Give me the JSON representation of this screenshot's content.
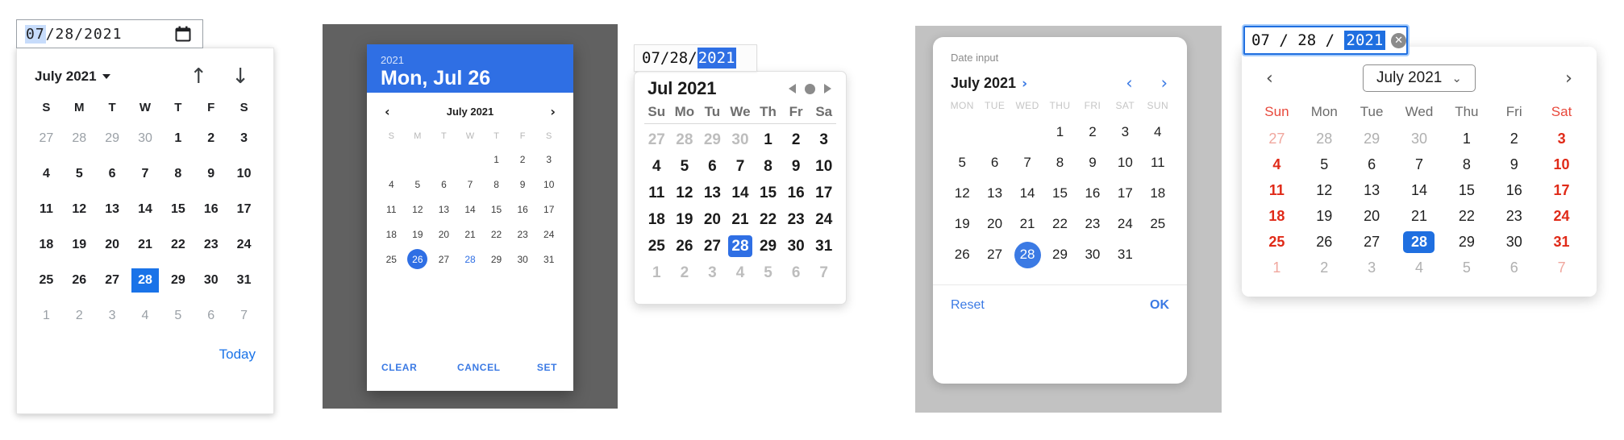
{
  "panels": {
    "chrome": {
      "name": "chrome-date-picker",
      "input": {
        "month": "07",
        "sep1": "/",
        "day": "28",
        "sep2": "/",
        "year": "2021",
        "icon": "calendar-icon",
        "selected_segment": "month"
      },
      "header": {
        "title": "July 2021",
        "dropdown_icon": "caret-down-icon",
        "prev_icon": "arrow-up-icon",
        "prev_glyph": "↑",
        "next_icon": "arrow-down-icon",
        "next_glyph": "↓"
      },
      "dow": [
        "S",
        "M",
        "T",
        "W",
        "T",
        "F",
        "S"
      ],
      "weeks": [
        [
          {
            "d": "27",
            "m": 1
          },
          {
            "d": "28",
            "m": 1
          },
          {
            "d": "29",
            "m": 1
          },
          {
            "d": "30",
            "m": 1
          },
          {
            "d": "1"
          },
          {
            "d": "2"
          },
          {
            "d": "3"
          }
        ],
        [
          {
            "d": "4"
          },
          {
            "d": "5"
          },
          {
            "d": "6"
          },
          {
            "d": "7"
          },
          {
            "d": "8"
          },
          {
            "d": "9"
          },
          {
            "d": "10"
          }
        ],
        [
          {
            "d": "11"
          },
          {
            "d": "12"
          },
          {
            "d": "13"
          },
          {
            "d": "14"
          },
          {
            "d": "15"
          },
          {
            "d": "16"
          },
          {
            "d": "17"
          }
        ],
        [
          {
            "d": "18"
          },
          {
            "d": "19"
          },
          {
            "d": "20"
          },
          {
            "d": "21"
          },
          {
            "d": "22"
          },
          {
            "d": "23"
          },
          {
            "d": "24"
          }
        ],
        [
          {
            "d": "25"
          },
          {
            "d": "26"
          },
          {
            "d": "27"
          },
          {
            "d": "28",
            "s": 1
          },
          {
            "d": "29"
          },
          {
            "d": "30"
          },
          {
            "d": "31"
          }
        ],
        [
          {
            "d": "1",
            "m": 1
          },
          {
            "d": "2",
            "m": 1
          },
          {
            "d": "3",
            "m": 1
          },
          {
            "d": "4",
            "m": 1
          },
          {
            "d": "5",
            "m": 1
          },
          {
            "d": "6",
            "m": 1
          },
          {
            "d": "7",
            "m": 1
          }
        ]
      ],
      "today_label": "Today",
      "accent": "#1a73e8",
      "selected_day": "28"
    },
    "material": {
      "name": "material-date-dialog",
      "header": {
        "year": "2021",
        "date": "Mon, Jul 26"
      },
      "nav": {
        "prev_glyph": "‹",
        "title": "July 2021",
        "next_glyph": "›"
      },
      "dow": [
        "S",
        "M",
        "T",
        "W",
        "T",
        "F",
        "S"
      ],
      "weeks": [
        [
          {
            "d": ""
          },
          {
            "d": ""
          },
          {
            "d": ""
          },
          {
            "d": ""
          },
          {
            "d": "1"
          },
          {
            "d": "2"
          },
          {
            "d": "3"
          }
        ],
        [
          {
            "d": "4"
          },
          {
            "d": "5"
          },
          {
            "d": "6"
          },
          {
            "d": "7"
          },
          {
            "d": "8"
          },
          {
            "d": "9"
          },
          {
            "d": "10"
          }
        ],
        [
          {
            "d": "11"
          },
          {
            "d": "12"
          },
          {
            "d": "13"
          },
          {
            "d": "14"
          },
          {
            "d": "15"
          },
          {
            "d": "16"
          },
          {
            "d": "17"
          }
        ],
        [
          {
            "d": "18"
          },
          {
            "d": "19"
          },
          {
            "d": "20"
          },
          {
            "d": "21"
          },
          {
            "d": "22"
          },
          {
            "d": "23"
          },
          {
            "d": "24"
          }
        ],
        [
          {
            "d": "25"
          },
          {
            "d": "26",
            "s": 1
          },
          {
            "d": "27"
          },
          {
            "d": "28",
            "t": 1
          },
          {
            "d": "29"
          },
          {
            "d": "30"
          },
          {
            "d": "31"
          }
        ]
      ],
      "buttons": {
        "clear": "CLEAR",
        "cancel": "CANCEL",
        "set": "SET"
      },
      "accent": "#2f6fe4",
      "scrim": "#616161",
      "selected_day": "26",
      "today_day": "28"
    },
    "safari": {
      "name": "safari-date-picker",
      "input": {
        "month": "07",
        "sep1": "/",
        "day": "28",
        "sep2": "/",
        "year": "2021",
        "selected_segment": "year"
      },
      "header": {
        "title": "Jul 2021",
        "prev_icon": "triangle-left-icon",
        "pause_icon": "circle-icon",
        "next_icon": "triangle-right-icon"
      },
      "dow": [
        "Su",
        "Mo",
        "Tu",
        "We",
        "Th",
        "Fr",
        "Sa"
      ],
      "weeks": [
        [
          {
            "d": "27",
            "m": 1
          },
          {
            "d": "28",
            "m": 1
          },
          {
            "d": "29",
            "m": 1
          },
          {
            "d": "30",
            "m": 1
          },
          {
            "d": "1"
          },
          {
            "d": "2"
          },
          {
            "d": "3"
          }
        ],
        [
          {
            "d": "4"
          },
          {
            "d": "5"
          },
          {
            "d": "6"
          },
          {
            "d": "7"
          },
          {
            "d": "8"
          },
          {
            "d": "9"
          },
          {
            "d": "10"
          }
        ],
        [
          {
            "d": "11"
          },
          {
            "d": "12"
          },
          {
            "d": "13"
          },
          {
            "d": "14"
          },
          {
            "d": "15"
          },
          {
            "d": "16"
          },
          {
            "d": "17"
          }
        ],
        [
          {
            "d": "18"
          },
          {
            "d": "19"
          },
          {
            "d": "20"
          },
          {
            "d": "21"
          },
          {
            "d": "22"
          },
          {
            "d": "23"
          },
          {
            "d": "24"
          }
        ],
        [
          {
            "d": "25"
          },
          {
            "d": "26"
          },
          {
            "d": "27"
          },
          {
            "d": "28",
            "s": 1
          },
          {
            "d": "29"
          },
          {
            "d": "30"
          },
          {
            "d": "31"
          }
        ],
        [
          {
            "d": "1",
            "m": 1
          },
          {
            "d": "2",
            "m": 1
          },
          {
            "d": "3",
            "m": 1
          },
          {
            "d": "4",
            "m": 1
          },
          {
            "d": "5",
            "m": 1
          },
          {
            "d": "6",
            "m": 1
          },
          {
            "d": "7",
            "m": 1
          }
        ]
      ],
      "accent": "#2f6fe4",
      "selected_day": "28"
    },
    "firefox": {
      "name": "firefox-date-sheet",
      "label": "Date input",
      "header": {
        "month": "July 2021",
        "expand_glyph": "›",
        "prev_glyph": "‹",
        "next_glyph": "›"
      },
      "dow": [
        "MON",
        "TUE",
        "WED",
        "THU",
        "FRI",
        "SAT",
        "SUN"
      ],
      "weeks": [
        [
          {
            "d": ""
          },
          {
            "d": ""
          },
          {
            "d": ""
          },
          {
            "d": "1"
          },
          {
            "d": "2"
          },
          {
            "d": "3"
          },
          {
            "d": "4"
          }
        ],
        [
          {
            "d": "5"
          },
          {
            "d": "6"
          },
          {
            "d": "7"
          },
          {
            "d": "8"
          },
          {
            "d": "9"
          },
          {
            "d": "10"
          },
          {
            "d": "11"
          }
        ],
        [
          {
            "d": "12"
          },
          {
            "d": "13"
          },
          {
            "d": "14"
          },
          {
            "d": "15"
          },
          {
            "d": "16"
          },
          {
            "d": "17"
          },
          {
            "d": "18"
          }
        ],
        [
          {
            "d": "19"
          },
          {
            "d": "20"
          },
          {
            "d": "21"
          },
          {
            "d": "22"
          },
          {
            "d": "23"
          },
          {
            "d": "24"
          },
          {
            "d": "25"
          }
        ],
        [
          {
            "d": "26"
          },
          {
            "d": "27"
          },
          {
            "d": "28",
            "s": 1
          },
          {
            "d": "29"
          },
          {
            "d": "30"
          },
          {
            "d": "31"
          },
          {
            "d": ""
          }
        ]
      ],
      "buttons": {
        "reset": "Reset",
        "ok": "OK"
      },
      "accent": "#3b7ae4",
      "scrim": "#c2c2c2",
      "selected_day": "28"
    },
    "edge": {
      "name": "edge-date-picker",
      "input": {
        "month": "07",
        "sep1": "/",
        "day": "28",
        "sep2": "/",
        "year": "2021",
        "clear_icon": "clear-circle-icon",
        "clear_glyph": "✕",
        "selected_segment": "year"
      },
      "header": {
        "prev_glyph": "‹",
        "month": "July 2021",
        "dropdown_glyph": "⌄",
        "next_glyph": "›"
      },
      "dow": [
        "Sun",
        "Mon",
        "Tue",
        "Wed",
        "Thu",
        "Fri",
        "Sat"
      ],
      "weeks": [
        [
          {
            "d": "27",
            "m": 1,
            "w": 1
          },
          {
            "d": "28",
            "m": 1
          },
          {
            "d": "29",
            "m": 1
          },
          {
            "d": "30",
            "m": 1
          },
          {
            "d": "1"
          },
          {
            "d": "2"
          },
          {
            "d": "3",
            "w": 1
          }
        ],
        [
          {
            "d": "4",
            "w": 1
          },
          {
            "d": "5"
          },
          {
            "d": "6"
          },
          {
            "d": "7"
          },
          {
            "d": "8"
          },
          {
            "d": "9"
          },
          {
            "d": "10",
            "w": 1
          }
        ],
        [
          {
            "d": "11",
            "w": 1
          },
          {
            "d": "12"
          },
          {
            "d": "13"
          },
          {
            "d": "14"
          },
          {
            "d": "15"
          },
          {
            "d": "16"
          },
          {
            "d": "17",
            "w": 1
          }
        ],
        [
          {
            "d": "18",
            "w": 1
          },
          {
            "d": "19"
          },
          {
            "d": "20"
          },
          {
            "d": "21"
          },
          {
            "d": "22"
          },
          {
            "d": "23"
          },
          {
            "d": "24",
            "w": 1
          }
        ],
        [
          {
            "d": "25",
            "w": 1
          },
          {
            "d": "26"
          },
          {
            "d": "27"
          },
          {
            "d": "28",
            "s": 1
          },
          {
            "d": "29"
          },
          {
            "d": "30"
          },
          {
            "d": "31",
            "w": 1
          }
        ],
        [
          {
            "d": "1",
            "m": 1,
            "w": 1
          },
          {
            "d": "2",
            "m": 1
          },
          {
            "d": "3",
            "m": 1
          },
          {
            "d": "4",
            "m": 1
          },
          {
            "d": "5",
            "m": 1
          },
          {
            "d": "6",
            "m": 1
          },
          {
            "d": "7",
            "m": 1,
            "w": 1
          }
        ]
      ],
      "accent": "#1f6fe0",
      "weekend_color": "#e02a18",
      "selected_day": "28"
    }
  }
}
